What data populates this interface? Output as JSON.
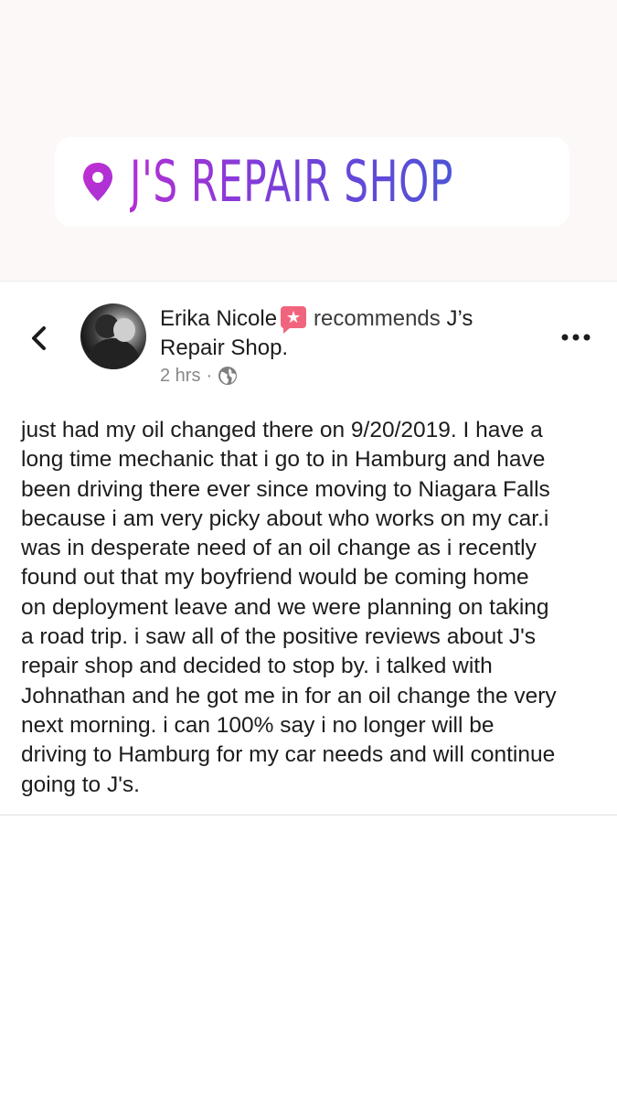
{
  "sticker": {
    "text": "J'S REPAIR SHOP",
    "colors": {
      "gradient_start": "#b230d4",
      "gradient_end": "#4d54d6"
    },
    "icon": "location-pin-icon"
  },
  "post": {
    "author": "Erika Nicole",
    "badge_icon": "recommendation-star-icon",
    "action": "recommends",
    "page_name_line1": "J’s",
    "page_name_line2": "Repair Shop",
    "period": ".",
    "time": "2 hrs",
    "separator": "·",
    "privacy_icon": "globe-icon",
    "lines": [
      "just had my oil changed there on 9/20/2019. I have a",
      "long time mechanic that i go to in Hamburg and have",
      "been driving there ever since moving to Niagara Falls",
      "because i am very picky about who works on my car.i",
      "was in desperate need of an oil change as i recently",
      "found out that my boyfriend would be coming home",
      "on deployment leave and we were planning on taking",
      "a road trip.  i saw all of the positive reviews about J's",
      "repair shop and decided to stop by. i talked with",
      "Johnathan and he got me in for an oil change the very",
      "next morning. i can 100% say i no longer will be",
      "driving to Hamburg for my car needs and will continue",
      "going to J's."
    ]
  },
  "nav": {
    "back_icon": "chevron-left-icon",
    "more_icon": "more-horizontal-icon"
  }
}
